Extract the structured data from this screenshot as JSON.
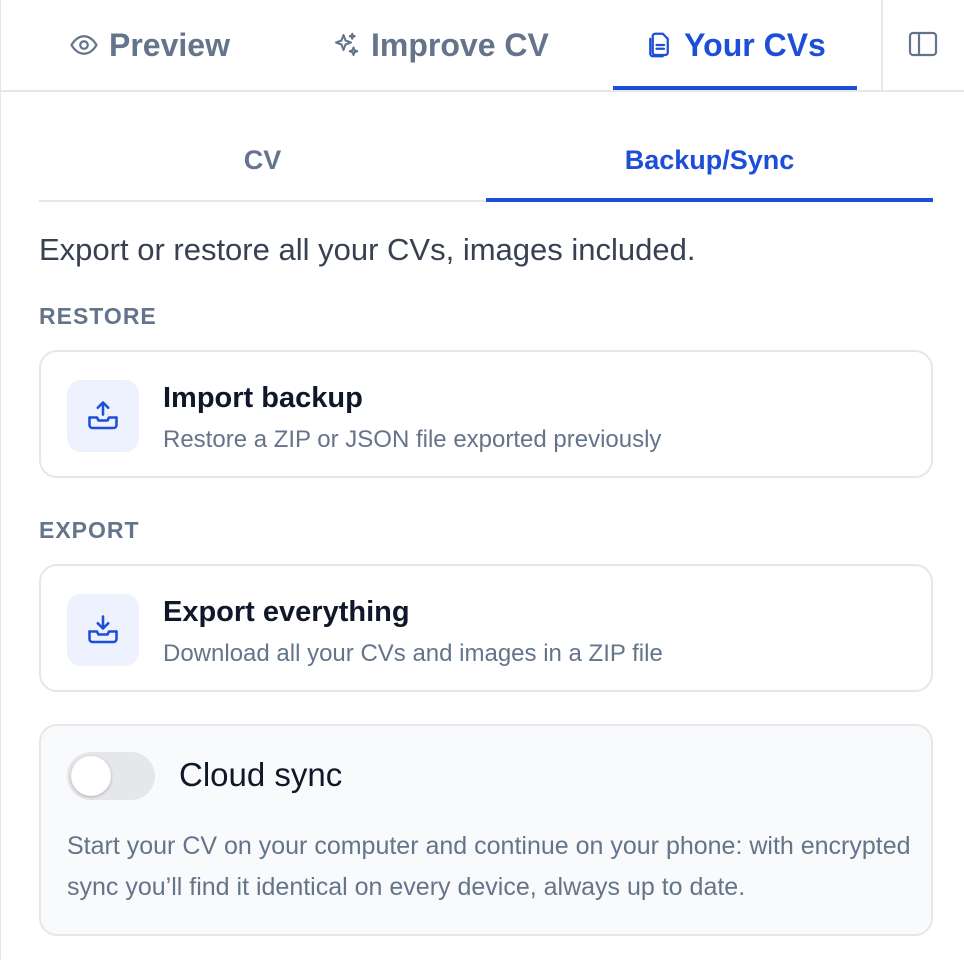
{
  "top_tabs": {
    "preview": "Preview",
    "improve": "Improve CV",
    "yours": "Your CVs"
  },
  "sub_tabs": {
    "cv": "CV",
    "backup": "Backup/Sync"
  },
  "intro": "Export or restore all your CVs, images included.",
  "restore": {
    "label": "RESTORE",
    "title": "Import backup",
    "desc": "Restore a ZIP or JSON file exported previously"
  },
  "export": {
    "label": "EXPORT",
    "title": "Export everything",
    "desc": "Download all your CVs and images in a ZIP file"
  },
  "sync": {
    "title": "Cloud sync",
    "enabled": false,
    "desc": "Start your CV on your computer and continue on your phone: with encrypted sync you’ll find it identical on every device, always up to date."
  },
  "colors": {
    "accent": "#1d4ed8",
    "muted": "#64748b",
    "border": "#e5e7eb",
    "icon_bg": "#eef2ff"
  }
}
